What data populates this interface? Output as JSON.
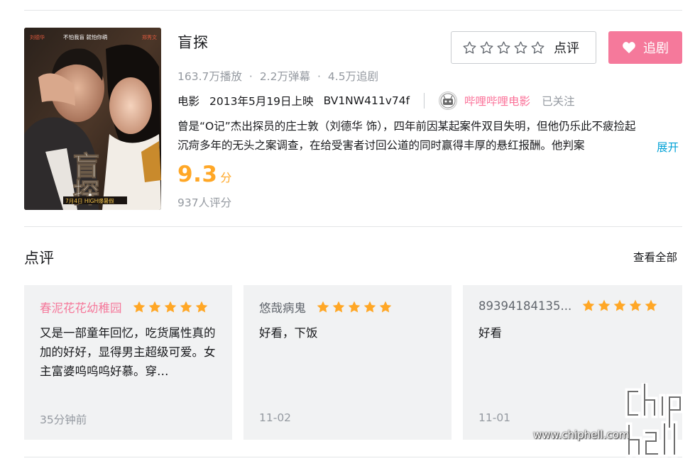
{
  "media": {
    "title": "盲探",
    "stats": {
      "plays": "163.7万播放",
      "danmaku": "2.2万弹幕",
      "follows": "4.5万追剧",
      "separator": "·"
    },
    "category": "电影",
    "release": "2013年5月19日上映",
    "bvid": "BV1NW411v74f",
    "publisher": {
      "name": "哔哩哔哩电影",
      "follow_state": "已关注"
    },
    "description": "曾是“O记”杰出探员的庄士敦（刘德华 饰），四年前因某起案件双目失明，但他仍乐此不疲捡起沉疴多年的无头之案调查，在给受害者讨回公道的同时赢得丰厚的悬红报酬。他判案",
    "expand_label": "展开",
    "score": {
      "value": "9.3",
      "unit": "分",
      "raters": "937人评分"
    },
    "poster": {
      "top_left_text": "刘德华",
      "top_center_text": "不怕我盲 就怕你萌",
      "top_right_text": "郑秀文",
      "title_text": "盲探",
      "bottom_text": "7月4日 HIGH爆暑假"
    }
  },
  "actions": {
    "rate_label": "点评",
    "follow_label": "追剧"
  },
  "reviews": {
    "title": "点评",
    "view_all": "查看全部",
    "items": [
      {
        "user": "春泥花花幼稚园",
        "stars": 5,
        "text": "又是一部童年回忆，吃货属性真的加的好好，显得男主超级可爱。女主富婆呜呜呜好慕。穿…",
        "time": "35分钟前"
      },
      {
        "user": "悠哉病鬼",
        "stars": 5,
        "text": "好看，下饭",
        "time": "11-02"
      },
      {
        "user": "89394184135...",
        "stars": 5,
        "text": "好看",
        "time": "11-01"
      }
    ]
  },
  "watermark": {
    "logo": "chiphell",
    "url": "www.chiphell.com"
  },
  "colors": {
    "accent_pink": "#f5799b",
    "link_blue": "#00a1d6",
    "score_orange": "#ffa726",
    "muted_gray": "#9499a0",
    "card_bg": "#f1f2f3"
  }
}
